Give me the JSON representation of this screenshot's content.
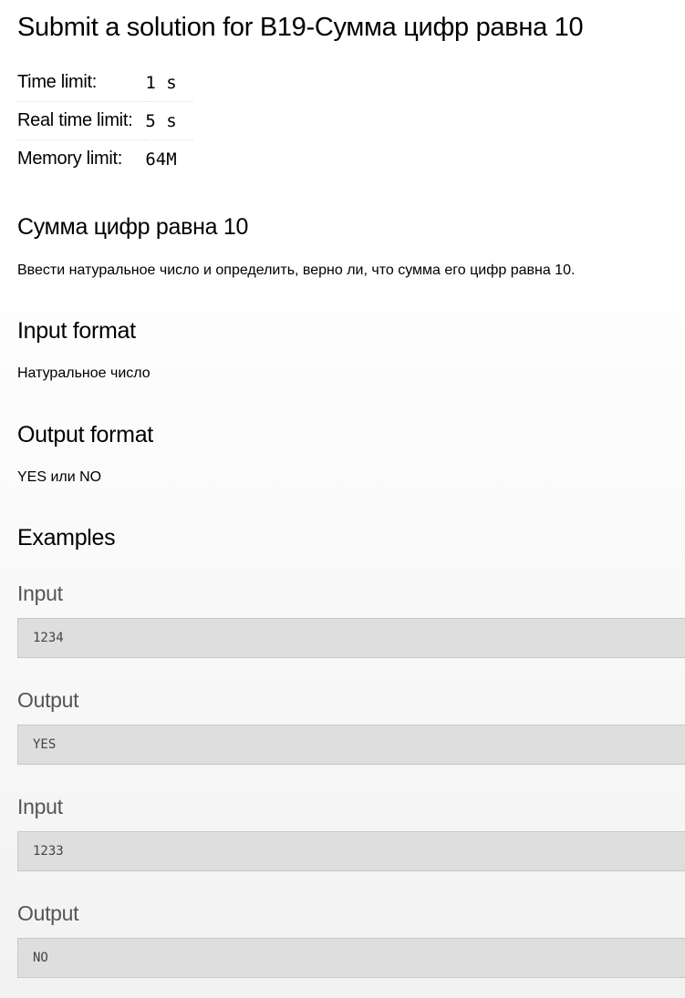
{
  "title": "Submit a solution for B19-Сумма цифр равна 10",
  "limits": [
    {
      "label": "Time limit:",
      "value": "1 s"
    },
    {
      "label": "Real time limit:",
      "value": "5 s"
    },
    {
      "label": "Memory limit:",
      "value": "64M"
    }
  ],
  "problem": {
    "heading": "Сумма цифр равна 10",
    "statement": "Ввести натуральное число и определить, верно ли, что сумма его цифр равна 10.",
    "input_heading": "Input format",
    "input_text": "Натуральное число",
    "output_heading": "Output format",
    "output_text": "YES или NO",
    "examples_heading": "Examples"
  },
  "examples": [
    {
      "label": "Input",
      "value": "1234"
    },
    {
      "label": "Output",
      "value": "YES"
    },
    {
      "label": "Input",
      "value": "1233"
    },
    {
      "label": "Output",
      "value": "NO"
    }
  ]
}
